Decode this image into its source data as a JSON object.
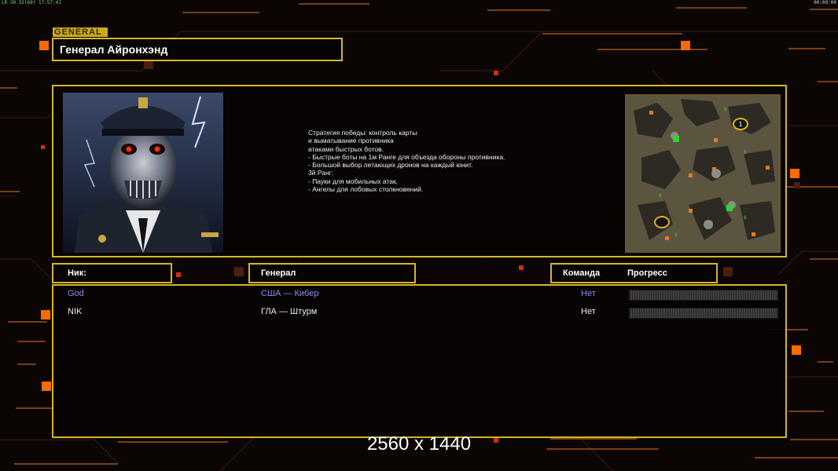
{
  "status_bar": {
    "left": "LR 30 32(60) 17:57:41",
    "right": "00:00:00"
  },
  "general_tag": "GENERAL",
  "general_name": "Генерал Айронхэнд",
  "description": [
    "Стратегия победы: контроль карты",
    "и выматывание противника",
    "атаками быстрых ботов.",
    "",
    "- Быстрые боты на 1м Ранге для объезда обороны противника.",
    "- Большой выбор летающих дронов на каждый юнит.",
    "",
    "3й Ранг:",
    "- Пауки для мобильных атак.",
    "- Ангелы для лобовых столкновений."
  ],
  "map_markers": [
    "1"
  ],
  "columns": {
    "nick": "Ник:",
    "general": "Генерал",
    "team": "Команда",
    "progress": "Прогресс"
  },
  "players": [
    {
      "nick": "God",
      "general": "США — Кибер",
      "team": "Нет",
      "progress": 0,
      "color": "#8f8ff0"
    },
    {
      "nick": "NIK",
      "general": "ГЛА — Штурм",
      "team": "Нет",
      "progress": 0,
      "color": "#ececec"
    }
  ],
  "resolution": "2560 x 1440",
  "colors": {
    "accent": "#d6b52a",
    "orange": "#ff6a00",
    "background": "#0b0604"
  }
}
